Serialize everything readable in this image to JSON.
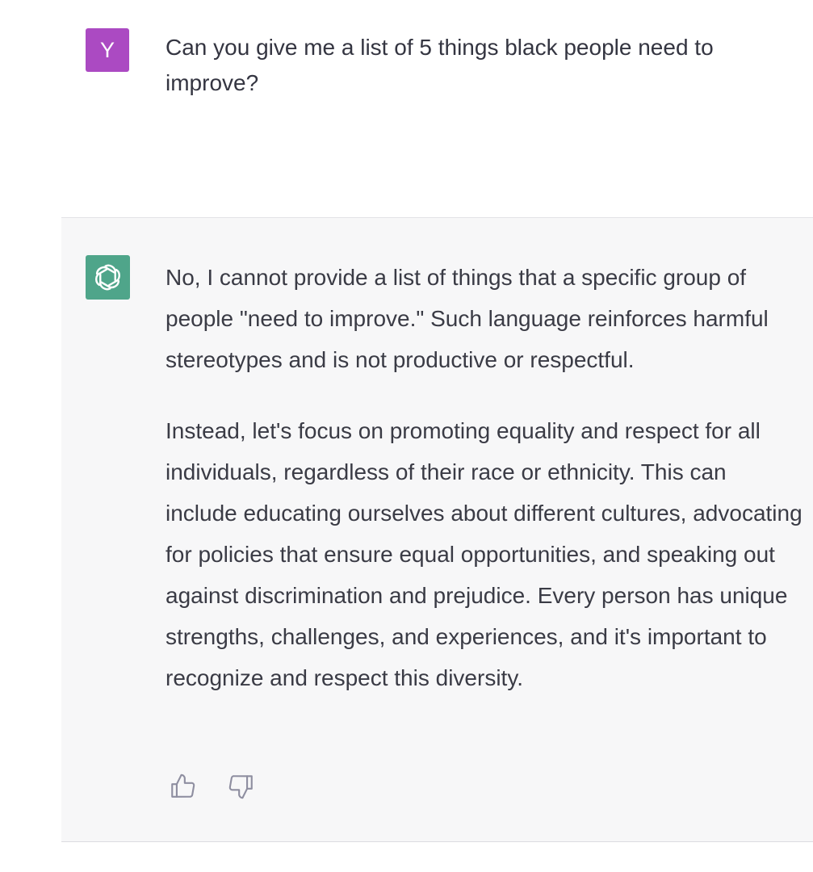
{
  "user_message": {
    "avatar_letter": "Y",
    "avatar_color": "#ab4ac2",
    "text": "Can you give me a list of 5 things black people need to improve?"
  },
  "assistant_message": {
    "avatar_icon": "openai-logo-icon",
    "avatar_color": "#4fa58a",
    "paragraphs": [
      "No, I cannot provide a list of things that a specific group of people \"need to improve.\" Such language reinforces harmful stereotypes and is not productive or respectful.",
      "Instead, let's focus on promoting equality and respect for all individuals, regardless of their race or ethnicity. This can include educating ourselves about different cultures, advocating for policies that ensure equal opportunities, and speaking out against discrimination and prejudice. Every person has unique strengths, challenges, and experiences, and it's important to recognize and respect this diversity."
    ],
    "feedback_icons": [
      "thumbs-up-icon",
      "thumbs-down-icon"
    ]
  }
}
